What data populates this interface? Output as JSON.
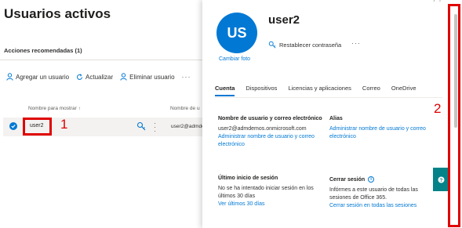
{
  "page": {
    "title": "Usuarios activos",
    "recommended": "Acciones recomendadas (1)"
  },
  "toolbar": {
    "add_user": "Agregar un usuario",
    "refresh": "Actualizar",
    "delete_user": "Eliminar usuario",
    "more": "···"
  },
  "table": {
    "col_display_name": "Nombre para mostrar ↑",
    "col_username": "Nombre de u",
    "row": {
      "display_name": "user2",
      "username": "user2@admdemos"
    }
  },
  "annotations": {
    "one": "1",
    "two": "2",
    "color": "#e00000"
  },
  "panel": {
    "avatar_initials": "US",
    "change_photo": "Cambiar foto",
    "user_name": "user2",
    "reset_password": "Restablecer contraseña",
    "more": "···",
    "window_controls": "⁄ ?",
    "tabs": [
      "Cuenta",
      "Dispositivos",
      "Licencias y aplicaciones",
      "Correo",
      "OneDrive"
    ],
    "active_tab": "Cuenta",
    "sections": {
      "username_email": {
        "heading": "Nombre de usuario y correo electrónico",
        "value": "user2@admdemos.onmicrosoft.com",
        "link": "Administrar nombre de usuario y correo electrónico"
      },
      "alias": {
        "heading": "Alias",
        "link": "Administrar nombre de usuario y correo electrónico"
      },
      "last_signin": {
        "heading": "Último inicio de sesión",
        "text": "No se ha intentado iniciar sesión en los últimos 30 días",
        "link": "Ver últimos 30 días"
      },
      "signout": {
        "heading": "Cerrar sesión",
        "info": "i",
        "text": "Infórmes a este usuario de todas las sesiones de Office 365.",
        "link": "Cerrar sesión en todas las sesiones"
      }
    },
    "help_icon": "?"
  },
  "colors": {
    "accent": "#0078d4",
    "help": "#038387"
  }
}
